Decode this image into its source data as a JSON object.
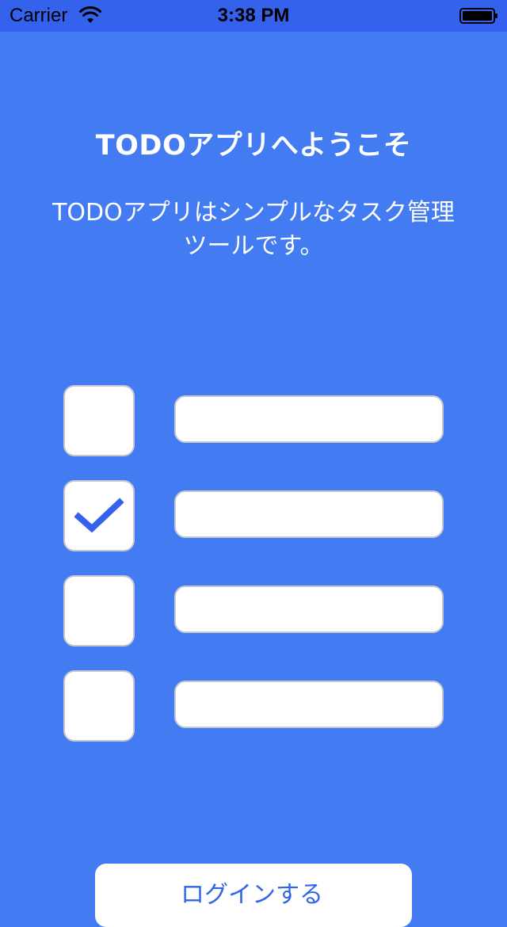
{
  "status_bar": {
    "carrier": "Carrier",
    "time": "3:38 PM",
    "wifi_icon": "wifi-icon",
    "battery_icon": "battery-icon"
  },
  "intro": {
    "title": "TODOアプリへようこそ",
    "description_line1": "TODOアプリはシンプルなタスク管理",
    "description_line2": "ツールです。"
  },
  "todo_items": [
    {
      "checked": false,
      "text": ""
    },
    {
      "checked": true,
      "text": ""
    },
    {
      "checked": false,
      "text": ""
    },
    {
      "checked": false,
      "text": ""
    }
  ],
  "check_icon": "checkmark-icon",
  "login_button": {
    "label": "ログインする"
  },
  "colors": {
    "background": "#437BF2",
    "status_bar": "#3562EC",
    "checkmark": "#3562EC",
    "button_text": "#2F66E6",
    "white": "#FFFFFF"
  }
}
